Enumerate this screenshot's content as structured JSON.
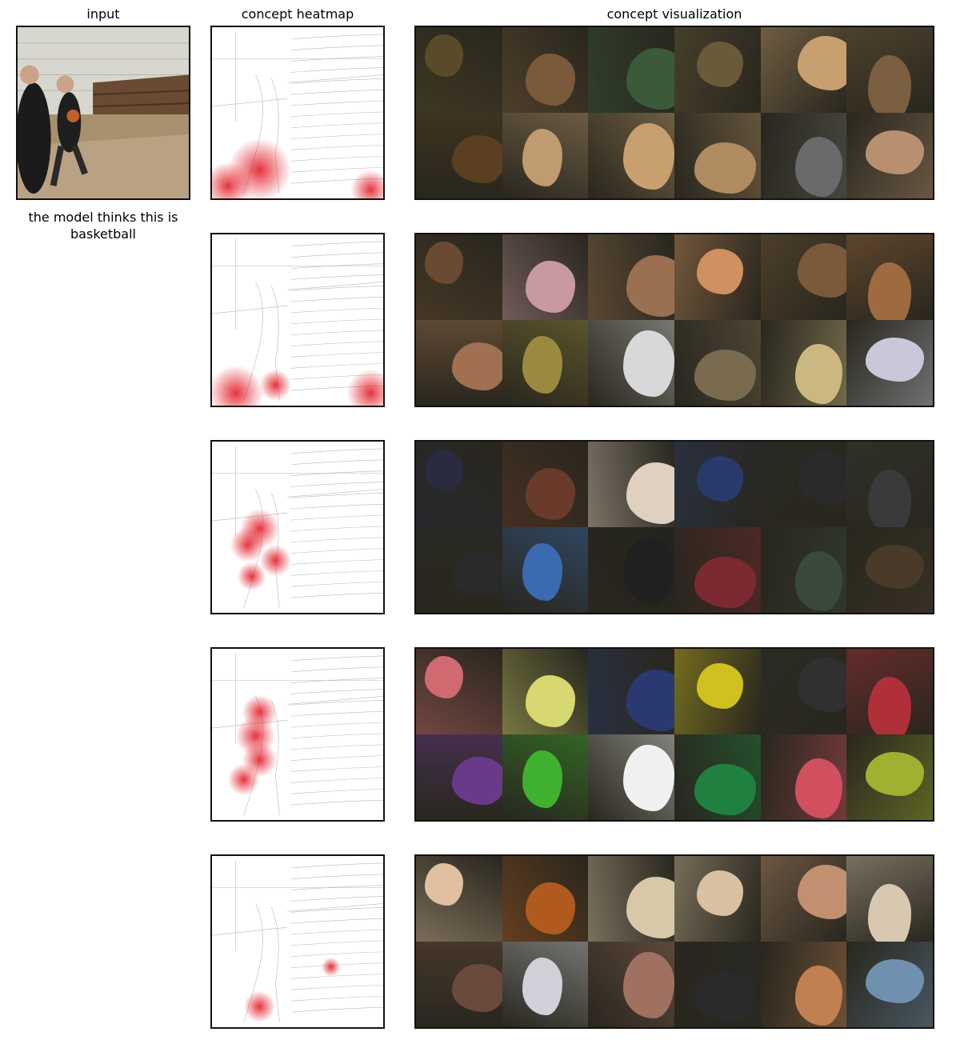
{
  "columns": {
    "input": "input",
    "heatmap": "concept heatmap",
    "visualization": "concept visualization"
  },
  "prediction_caption": "the model thinks this is basketball",
  "input_image": {
    "icon": "basketball-gym-photo",
    "palette": [
      "#d8d7cf",
      "#8c6e4f",
      "#3a2a22",
      "#b6a28a",
      "#1b1b1b"
    ]
  },
  "concepts": [
    {
      "heatmap_icon": "heatmap-floor-lower-left",
      "heat_color": "#e0101a",
      "tiles": [
        "#5a4a2a",
        "#7a5a3a",
        "#3a5a3a",
        "#6a5a3a",
        "#c8a070",
        "#7a5f40",
        "#5a4020",
        "#c09a70",
        "#c8a070",
        "#b08a60",
        "#6a6a6a",
        "#b89070"
      ]
    },
    {
      "heatmap_icon": "heatmap-floor-edges",
      "heat_color": "#e0101a",
      "tiles": [
        "#6a4a30",
        "#c89aa0",
        "#9a7050",
        "#d09060",
        "#7a5a3a",
        "#a06a40",
        "#a07050",
        "#9a8a40",
        "#d8d8d8",
        "#7a6a50",
        "#cbb880",
        "#c8c8d8"
      ]
    },
    {
      "heatmap_icon": "heatmap-player-figure",
      "heat_color": "#e0101a",
      "tiles": [
        "#2a2a40",
        "#6a3a2a",
        "#e0d0c0",
        "#2a3a6a",
        "#2a2a2a",
        "#3a3a3a",
        "#2a2a2a",
        "#3a6ab0",
        "#202020",
        "#7a2a30",
        "#3a4a3a",
        "#4a3a2a"
      ]
    },
    {
      "heatmap_icon": "heatmap-ball-and-player",
      "heat_color": "#e0101a",
      "tiles": [
        "#d06a70",
        "#d8d870",
        "#2a3a70",
        "#d0c020",
        "#303030",
        "#b0303a",
        "#6a3a8a",
        "#40b030",
        "#f0f0f0",
        "#208040",
        "#d05060",
        "#a0b030"
      ]
    },
    {
      "heatmap_icon": "heatmap-floor-faint",
      "heat_color": "#e0101a",
      "tiles": [
        "#e0c0a0",
        "#b05a20",
        "#d8c8a8",
        "#d8c0a0",
        "#c09070",
        "#d8c8b0",
        "#6a4a3a",
        "#cfd0d8",
        "#a07060",
        "#2a2a2a",
        "#c08050",
        "#7090b0"
      ]
    }
  ]
}
